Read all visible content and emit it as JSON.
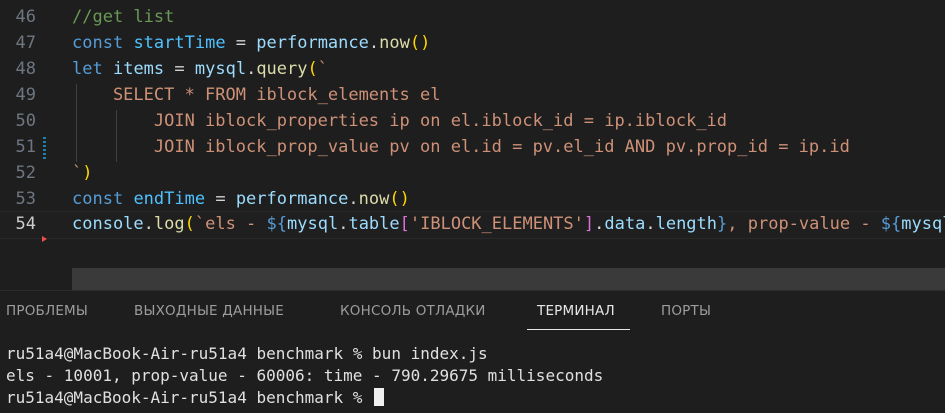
{
  "editor": {
    "lines": [
      {
        "num": "46",
        "tokens": [
          {
            "t": "//get list",
            "c": "comment"
          }
        ]
      },
      {
        "num": "47",
        "tokens": [
          {
            "t": "const",
            "c": "kw"
          },
          {
            "t": " ",
            "c": "punc"
          },
          {
            "t": "startTime",
            "c": "const"
          },
          {
            "t": " = ",
            "c": "punc"
          },
          {
            "t": "performance",
            "c": "var"
          },
          {
            "t": ".",
            "c": "punc"
          },
          {
            "t": "now",
            "c": "fn"
          },
          {
            "t": "()",
            "c": "paren"
          }
        ]
      },
      {
        "num": "48",
        "tokens": [
          {
            "t": "let",
            "c": "kw"
          },
          {
            "t": " ",
            "c": "punc"
          },
          {
            "t": "items",
            "c": "var"
          },
          {
            "t": " = ",
            "c": "punc"
          },
          {
            "t": "mysql",
            "c": "var"
          },
          {
            "t": ".",
            "c": "punc"
          },
          {
            "t": "query",
            "c": "fn"
          },
          {
            "t": "(",
            "c": "paren"
          },
          {
            "t": "`",
            "c": "str"
          }
        ]
      },
      {
        "num": "49",
        "tokens": [
          {
            "t": "    SELECT * FROM iblock_elements el",
            "c": "str"
          }
        ]
      },
      {
        "num": "50",
        "tokens": [
          {
            "t": "        JOIN iblock_properties ip on el.iblock_id = ip.iblock_id",
            "c": "str"
          }
        ]
      },
      {
        "num": "51",
        "tokens": [
          {
            "t": "        JOIN iblock_prop_value pv on el.id = pv.el_id AND pv.prop_id = ip.id",
            "c": "str"
          }
        ]
      },
      {
        "num": "52",
        "tokens": [
          {
            "t": "`",
            "c": "str"
          },
          {
            "t": ")",
            "c": "paren"
          }
        ]
      },
      {
        "num": "53",
        "tokens": [
          {
            "t": "const",
            "c": "kw"
          },
          {
            "t": " ",
            "c": "punc"
          },
          {
            "t": "endTime",
            "c": "const"
          },
          {
            "t": " = ",
            "c": "punc"
          },
          {
            "t": "performance",
            "c": "var"
          },
          {
            "t": ".",
            "c": "punc"
          },
          {
            "t": "now",
            "c": "fn"
          },
          {
            "t": "()",
            "c": "paren"
          }
        ]
      },
      {
        "num": "54",
        "current": true,
        "tokens": [
          {
            "t": "console",
            "c": "var"
          },
          {
            "t": ".",
            "c": "punc"
          },
          {
            "t": "log",
            "c": "fn"
          },
          {
            "t": "(",
            "c": "paren"
          },
          {
            "t": "`els - ",
            "c": "str"
          },
          {
            "t": "${",
            "c": "tpl"
          },
          {
            "t": "mysql",
            "c": "var"
          },
          {
            "t": ".",
            "c": "punc"
          },
          {
            "t": "table",
            "c": "var"
          },
          {
            "t": "[",
            "c": "bracket"
          },
          {
            "t": "'IBLOCK_ELEMENTS'",
            "c": "str"
          },
          {
            "t": "]",
            "c": "bracket"
          },
          {
            "t": ".",
            "c": "punc"
          },
          {
            "t": "data",
            "c": "var"
          },
          {
            "t": ".",
            "c": "punc"
          },
          {
            "t": "length",
            "c": "var"
          },
          {
            "t": "}",
            "c": "tpl"
          },
          {
            "t": ", prop-value - ",
            "c": "str"
          },
          {
            "t": "${",
            "c": "tpl"
          },
          {
            "t": "mysql",
            "c": "var"
          }
        ]
      }
    ]
  },
  "panel": {
    "tabs": [
      {
        "label": "ПРОБЛЕМЫ",
        "active": false
      },
      {
        "label": "ВЫХОДНЫЕ ДАННЫЕ",
        "active": false
      },
      {
        "label": "КОНСОЛЬ ОТЛАДКИ",
        "active": false
      },
      {
        "label": "ТЕРМИНАЛ",
        "active": true
      },
      {
        "label": "ПОРТЫ",
        "active": false
      }
    ]
  },
  "terminal": {
    "lines": [
      "ru51a4@MacBook-Air-ru51a4 benchmark % bun index.js",
      "els - 10001, prop-value - 60006: time - 790.29675 milliseconds"
    ],
    "prompt": "ru51a4@MacBook-Air-ru51a4 benchmark % "
  },
  "colors": {
    "background": "#1e1e1e",
    "keyword": "#569cd6",
    "string": "#ce9178",
    "function": "#dcdcaa",
    "variable": "#9cdcfe",
    "comment": "#6a9955"
  }
}
